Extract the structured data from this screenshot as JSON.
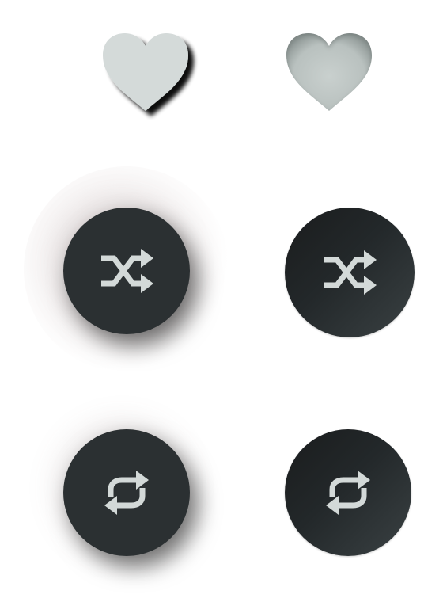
{
  "colors": {
    "icon_fill": "#d3d9d8",
    "button_dark": "#2b3032",
    "heart_light": "#d4dad9"
  },
  "controls": {
    "like_flat": {
      "icon": "heart-icon"
    },
    "like_soft": {
      "icon": "heart-icon"
    },
    "shuffle_flat": {
      "icon": "shuffle-icon"
    },
    "shuffle_gradient": {
      "icon": "shuffle-icon"
    },
    "repeat_flat": {
      "icon": "repeat-icon"
    },
    "repeat_gradient": {
      "icon": "repeat-icon"
    }
  }
}
